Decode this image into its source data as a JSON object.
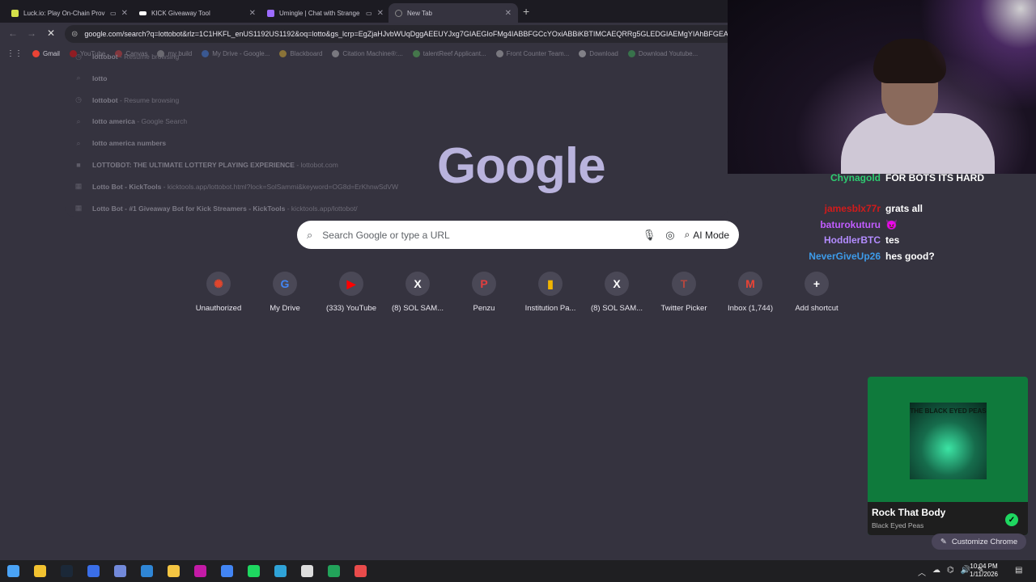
{
  "tabs": [
    {
      "label": "Luck.io: Play On-Chain Prov",
      "icon": "luck-icon",
      "color": "#d4e04a"
    },
    {
      "label": "KICK Giveaway Tool",
      "icon": "kick-icon",
      "color": "#ffffff"
    },
    {
      "label": "Umingle | Chat with Strange",
      "icon": "umingle-icon",
      "color": "#9c6bff"
    },
    {
      "label": "New Tab",
      "icon": "loading-icon",
      "color": "#888888"
    }
  ],
  "omnibox": {
    "url": "google.com/search?q=lottobot&rlz=1C1HKFL_enUS1192US1192&oq=lotto&gs_lcrp=EgZjaHJvbWUqDggAEEUYJxg7GIAEGIoFMg4IABBFGCcYOxiABBiKBTIMCAEQRRg5GLEDGIAEMgYIAhBFGEAyB"
  },
  "bookmarks": [
    {
      "label": "Gmail",
      "color": "#ea4335"
    },
    {
      "label": "YouTube",
      "color": "#ff0000"
    },
    {
      "label": "Canvas",
      "color": "#e13c3c"
    },
    {
      "label": "my build",
      "color": "#aaaaaa"
    },
    {
      "label": "My Drive - Google...",
      "color": "#4285f4"
    },
    {
      "label": "Blackboard",
      "color": "#f2c230"
    },
    {
      "label": "Citation Machine®:...",
      "color": "#cccccc"
    },
    {
      "label": "talentReef Applicant...",
      "color": "#5ac85a"
    },
    {
      "label": "Front Counter Team...",
      "color": "#cccccc"
    },
    {
      "label": "Download",
      "color": "#dddddd"
    },
    {
      "label": "Download Youtube...",
      "color": "#3dbf5a"
    }
  ],
  "suggestions": [
    {
      "main": "lottobot",
      "rest": " - Resume browsing",
      "icon": "history-icon"
    },
    {
      "main": "lotto",
      "rest": "",
      "icon": "search-icon"
    },
    {
      "main": "lottobot",
      "rest": " - Resume browsing",
      "icon": "history-icon"
    },
    {
      "main": "lotto america",
      "rest": " - Google Search",
      "icon": "search-icon"
    },
    {
      "main": "lotto america numbers",
      "rest": "",
      "icon": "search-icon"
    },
    {
      "main": "LOTTOBOT: THE ULTIMATE LOTTERY PLAYING EXPERIENCE",
      "rest": " - lottobot.com",
      "icon": "site-icon"
    },
    {
      "main": "Lotto Bot - KickTools",
      "rest": " - kicktools.app/lottobot.html?lock=SolSammi&keyword=OG8d=ErKhnwSdVW",
      "icon": "grid-icon"
    },
    {
      "main": "Lotto Bot - #1 Giveaway Bot for Kick Streamers - KickTools",
      "rest": " - kicktools.app/lottobot/",
      "icon": "grid-icon"
    }
  ],
  "google": {
    "logo": "Google"
  },
  "search": {
    "placeholder": "Search Google or type a URL",
    "ai_mode": "AI Mode"
  },
  "shortcuts": [
    {
      "label": "Unauthorized",
      "glyph": "✺",
      "color": "#e0462d"
    },
    {
      "label": "My Drive",
      "glyph": "G",
      "color": "#4285f4"
    },
    {
      "label": "(333) YouTube",
      "glyph": "▶",
      "color": "#ff0000"
    },
    {
      "label": "(8) SOL SAM...",
      "glyph": "X",
      "color": "#000000"
    },
    {
      "label": "Penzu",
      "glyph": "P",
      "color": "#e23e3e"
    },
    {
      "label": "Institution Pa...",
      "glyph": "▮",
      "color": "#f0b400"
    },
    {
      "label": "(8) SOL SAM...",
      "glyph": "X",
      "color": "#000000"
    },
    {
      "label": "Twitter Picker",
      "glyph": "T",
      "color": "#b3473f"
    },
    {
      "label": "Inbox (1,744)",
      "glyph": "M",
      "color": "#ea4335"
    },
    {
      "label": "Add shortcut",
      "glyph": "+",
      "color": "#4a4856"
    }
  ],
  "chat": [
    {
      "user": "Chynagold",
      "message": "FOR BOTS ITS HARD",
      "color": "#2ecc71"
    },
    {
      "user": "",
      "message": "",
      "color": "#e05050"
    },
    {
      "user": "jamesblx77r",
      "message": "grats all",
      "color": "#d21b1b"
    },
    {
      "user": "baturokuturu",
      "message": "😈",
      "color": "#c15cff"
    },
    {
      "user": "HoddlerBTC",
      "message": "tes",
      "color": "#b38cff"
    },
    {
      "user": "NeverGiveUp26",
      "message": "hes good?",
      "color": "#3d9be9"
    }
  ],
  "spotify": {
    "song": "Rock That Body",
    "artist": "Black Eyed Peas",
    "album_text": "THE BLACK EYED PEAS"
  },
  "customize": {
    "label": "Customize Chrome"
  },
  "taskbar": {
    "apps": [
      "windows-start",
      "file-explorer",
      "steam",
      "edge-dev",
      "discord",
      "vscode",
      "chrome-canary",
      "kick-next",
      "chrome",
      "spotify",
      "edge",
      "settings-gear",
      "terminal",
      "obs"
    ],
    "time": "10:04 PM",
    "date": "1/11/2026"
  }
}
